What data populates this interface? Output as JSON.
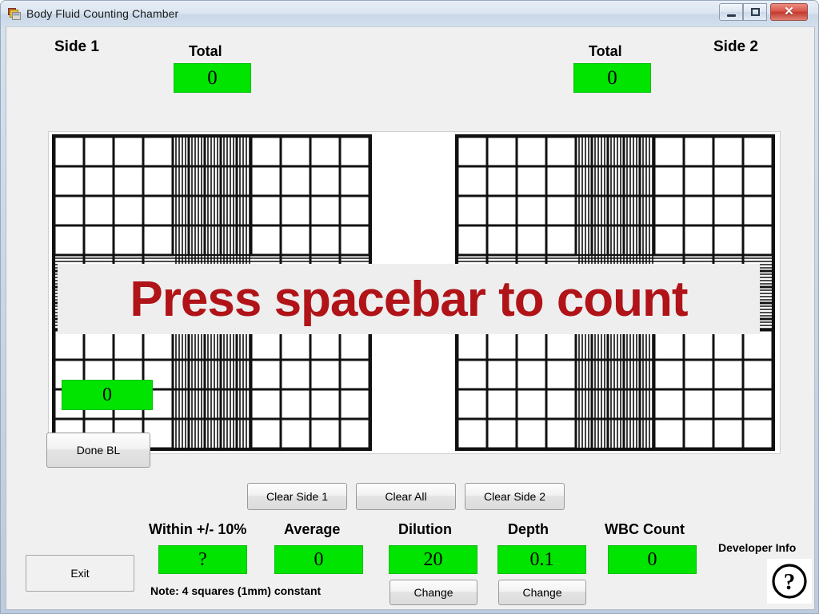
{
  "window": {
    "title": "Body Fluid Counting Chamber",
    "app_icon": "form-application-icon",
    "controls": {
      "minimize": "minimize-icon",
      "maximize": "restore-icon",
      "close": "✕"
    }
  },
  "header": {
    "side1_label": "Side 1",
    "side2_label": "Side 2",
    "total_left_label": "Total",
    "total_left_value": "0",
    "total_right_label": "Total",
    "total_right_value": "0"
  },
  "chamber": {
    "banner_text": "Press spacebar to count",
    "square_counter_value": "0",
    "done_button": "Done BL"
  },
  "clear_buttons": {
    "clear_side_1": "Clear Side 1",
    "clear_all": "Clear All",
    "clear_side_2": "Clear Side 2"
  },
  "stats": {
    "within_label": "Within +/- 10%",
    "within_value": "?",
    "average_label": "Average",
    "average_value": "0",
    "dilution_label": "Dilution",
    "dilution_value": "20",
    "dilution_change": "Change",
    "depth_label": "Depth",
    "depth_value": "0.1",
    "depth_change": "Change",
    "wbc_label": "WBC Count",
    "wbc_value": "0",
    "note": "Note: 4 squares (1mm) constant"
  },
  "footer": {
    "exit_label": "Exit",
    "developer_info_label": "Developer Info",
    "help_icon": "question-mark-circle-icon"
  },
  "colors": {
    "value_green": "#00e400",
    "banner_red": "#b01318",
    "client_bg": "#f0f0f0"
  }
}
